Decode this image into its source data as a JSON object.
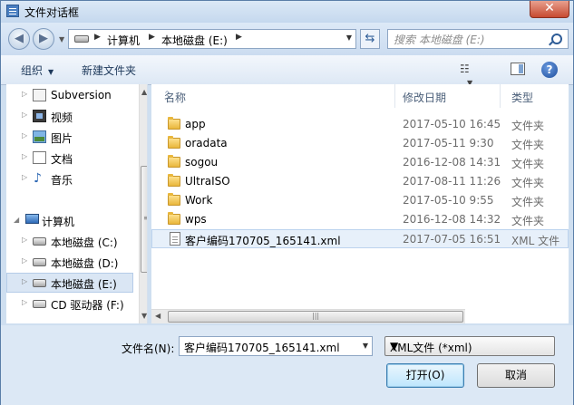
{
  "window": {
    "title": "文件对话框",
    "close_glyph": "✕"
  },
  "nav": {
    "back_glyph": "◀",
    "forward_glyph": "▶",
    "breadcrumb": [
      "计算机",
      "本地磁盘 (E:)"
    ],
    "search_placeholder": "搜索 本地磁盘 (E:)"
  },
  "toolbar": {
    "organize_label": "组织",
    "new_folder_label": "新建文件夹",
    "help_glyph": "?"
  },
  "sidebar": {
    "items": [
      {
        "label": "Subversion",
        "icon": "subversion-icon"
      },
      {
        "label": "视频",
        "icon": "video-icon"
      },
      {
        "label": "图片",
        "icon": "picture-icon"
      },
      {
        "label": "文档",
        "icon": "document-icon"
      },
      {
        "label": "音乐",
        "icon": "music-icon"
      },
      {
        "label": "计算机",
        "icon": "computer-icon"
      },
      {
        "label": "本地磁盘 (C:)",
        "icon": "drive-icon"
      },
      {
        "label": "本地磁盘 (D:)",
        "icon": "drive-icon"
      },
      {
        "label": "本地磁盘 (E:)",
        "icon": "drive-icon",
        "selected": true
      },
      {
        "label": "CD 驱动器 (F:)",
        "icon": "cd-drive-icon"
      }
    ]
  },
  "files": {
    "columns": {
      "name": "名称",
      "date": "修改日期",
      "type": "类型"
    },
    "rows": [
      {
        "name": "app",
        "date": "2017-05-10 16:45",
        "type": "文件夹",
        "icon": "folder-icon"
      },
      {
        "name": "oradata",
        "date": "2017-05-11 9:30",
        "type": "文件夹",
        "icon": "folder-icon"
      },
      {
        "name": "sogou",
        "date": "2016-12-08 14:31",
        "type": "文件夹",
        "icon": "folder-icon"
      },
      {
        "name": "UltraISO",
        "date": "2017-08-11 11:26",
        "type": "文件夹",
        "icon": "folder-icon"
      },
      {
        "name": "Work",
        "date": "2017-05-10 9:55",
        "type": "文件夹",
        "icon": "folder-icon"
      },
      {
        "name": "wps",
        "date": "2016-12-08 14:32",
        "type": "文件夹",
        "icon": "folder-icon"
      },
      {
        "name": "客户编码170705_165141.xml",
        "date": "2017-07-05 16:51",
        "type": "XML 文件",
        "icon": "xml-file-icon",
        "selected": true
      }
    ]
  },
  "footer": {
    "filename_label": "文件名(N):",
    "filename_value": "客户编码170705_165141.xml",
    "filetype_value": "XML文件 (*xml)",
    "open_label": "打开(O)",
    "cancel_label": "取消"
  },
  "colors": {
    "selection": "#dae6f4",
    "frame": "#cfdff0",
    "close": "#c74a31"
  }
}
